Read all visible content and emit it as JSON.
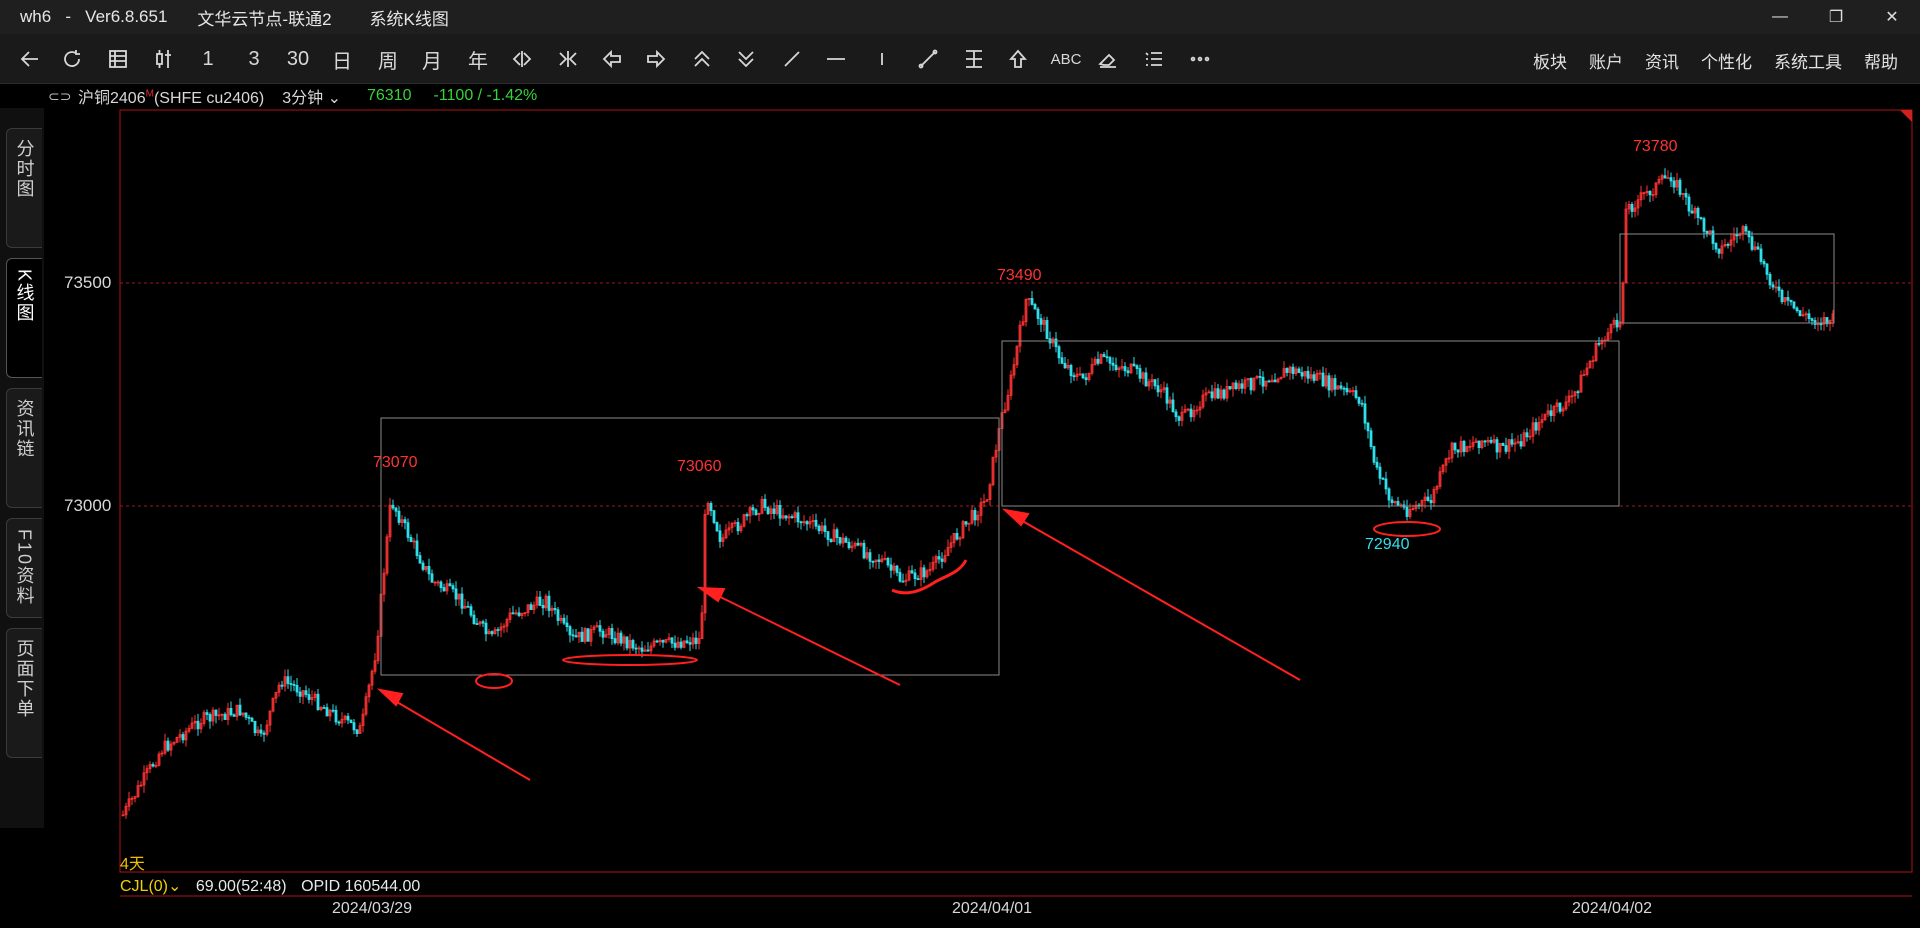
{
  "titlebar": {
    "app": "wh6   -   Ver6.8.651",
    "node": "文华云节点-联通2",
    "view": "系统K线图",
    "minimize": "—",
    "restore": "❐",
    "close": "✕"
  },
  "toolbar": {
    "text_tools": {
      "period1": "1",
      "period3": "3",
      "period30": "30",
      "day": "日",
      "week": "周",
      "month": "月",
      "year": "年",
      "abc": "ABC"
    },
    "menu": [
      "板块",
      "账户",
      "资讯",
      "个性化",
      "系统工具",
      "帮助"
    ]
  },
  "infobar": {
    "symbol": "沪铜2406",
    "marker": "M",
    "code": "(SHFE cu2406)",
    "period": "3分钟",
    "price": "76310",
    "change": "-1100 / -1.42%"
  },
  "lefttabs": [
    "分时图",
    "K线图",
    "资讯链",
    "F10资料",
    "页面下单"
  ],
  "chart": {
    "y_ticks": [
      "73500",
      "73000"
    ],
    "x_ticks": [
      "2024/03/29",
      "2024/04/01",
      "2024/04/02"
    ],
    "annotations": {
      "high1": "73070",
      "high2": "73060",
      "high3": "73490",
      "low1": "72940",
      "high4": "73780"
    },
    "days_label": "4天",
    "indicator": {
      "name": "CJL(0)",
      "value": "69.00(52:48)",
      "opid": "OPID 160544.00"
    },
    "colors": {
      "up": "#ff3333",
      "down": "#2fe0ec",
      "box": "#8a8a8a",
      "arrow": "#ff2020"
    }
  }
}
